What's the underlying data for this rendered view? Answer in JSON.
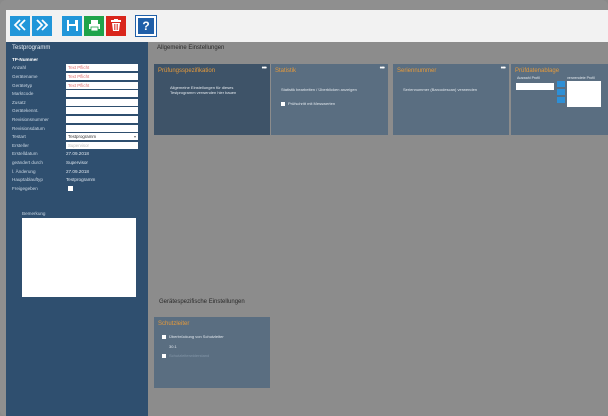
{
  "toolbar": {
    "buttons": [
      {
        "icon": "double-chevron-left-icon",
        "color": "#2196d9"
      },
      {
        "icon": "double-chevron-right-icon",
        "color": "#2196d9"
      },
      {
        "icon": "save-icon",
        "color": "#2196d9"
      },
      {
        "icon": "print-icon",
        "color": "#1fa34a"
      },
      {
        "icon": "trash-icon",
        "color": "#d9261c"
      },
      {
        "icon": "help-icon",
        "color": "#1f5fa8"
      }
    ],
    "help_glyph": "?"
  },
  "sidebar": {
    "title": "Testprogramm",
    "fields": [
      {
        "label": "TP-Nummer",
        "type": "text-bold",
        "value": ""
      },
      {
        "label": "Anzahl",
        "type": "input",
        "value": "Text Pflicht"
      },
      {
        "label": "Gerätename",
        "type": "input",
        "value": "Text Pflicht"
      },
      {
        "label": "Gerätetyp",
        "type": "input",
        "value": "Text Pflicht"
      },
      {
        "label": "Marktcode",
        "type": "input",
        "value": ""
      },
      {
        "label": "Zusatz",
        "type": "input",
        "value": ""
      },
      {
        "label": "Gerätekennt.",
        "type": "input",
        "value": ""
      },
      {
        "label": "Revisionsnummer",
        "type": "input",
        "value": ""
      },
      {
        "label": "Revisionsdatum",
        "type": "input",
        "value": ""
      },
      {
        "label": "Testart",
        "type": "select",
        "value": "Testprogramm"
      },
      {
        "label": "Ersteller",
        "type": "input",
        "value": "Supervisor"
      },
      {
        "label": "Erstelldatum",
        "type": "value",
        "value": "27.09.2018"
      },
      {
        "label": "geändert durch",
        "type": "value",
        "value": "Supervisor"
      },
      {
        "label": "l. Änderung",
        "type": "value",
        "value": "27.09.2018"
      },
      {
        "label": "Hauptablauftyp",
        "type": "value",
        "value": "Testprogramm"
      },
      {
        "label": "Freigegeben",
        "type": "check",
        "value": ""
      }
    ],
    "comment_label": "Bemerkung"
  },
  "main": {
    "section1_title": "Allgemeine Einstellungen",
    "section2_title": "Gerätespezifische Einstellungen",
    "cards": [
      {
        "title": "Prüfungsspezifikation",
        "lines": [
          "Allgemeine Einstellungen für dieses",
          "Testprogramm verwenden hier bauen"
        ]
      },
      {
        "title": "Statistik",
        "lines": [
          "Statistik bearbeiten / Überblicken anzeigen"
        ],
        "check_label": "Prüfschritt mit Messwerten"
      },
      {
        "title": "Seriennummer",
        "lines": [
          "Seriennummer (Barcodescan) verwenden"
        ]
      },
      {
        "title": "Prüfdatenablage",
        "left_label": "Auswahl Profil",
        "right_label": "verwendete Profil"
      }
    ],
    "device_card": {
      "title": "Schutzleiter",
      "check1": "Überbrückung von Schutzleiter",
      "value": "30.1",
      "check2": "Schutzleiterwiderstand"
    }
  }
}
